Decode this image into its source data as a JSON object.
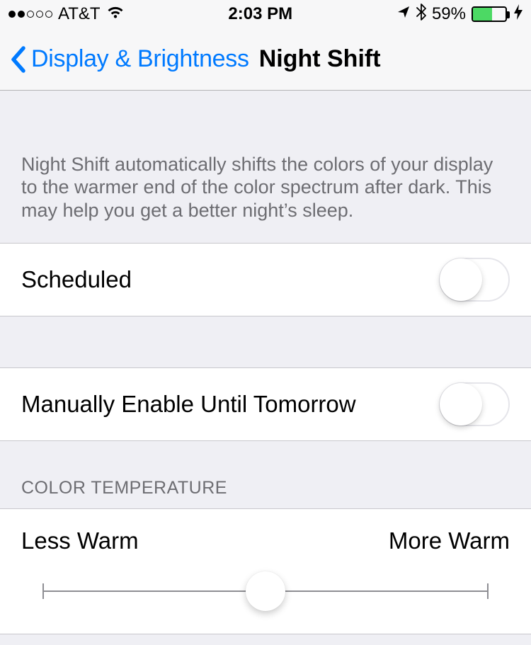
{
  "status": {
    "carrier": "AT&T",
    "time": "2:03 PM",
    "battery_pct": "59%"
  },
  "nav": {
    "back_label": "Display & Brightness",
    "title": "Night Shift"
  },
  "sections": {
    "intro": "Night Shift automatically shifts the colors of your display to the warmer end of the color spectrum after dark. This may help you get a better night’s sleep.",
    "scheduled_label": "Scheduled",
    "manual_label": "Manually Enable Until Tomorrow",
    "color_temp_header": "COLOR TEMPERATURE",
    "less_warm": "Less Warm",
    "more_warm": "More Warm"
  }
}
